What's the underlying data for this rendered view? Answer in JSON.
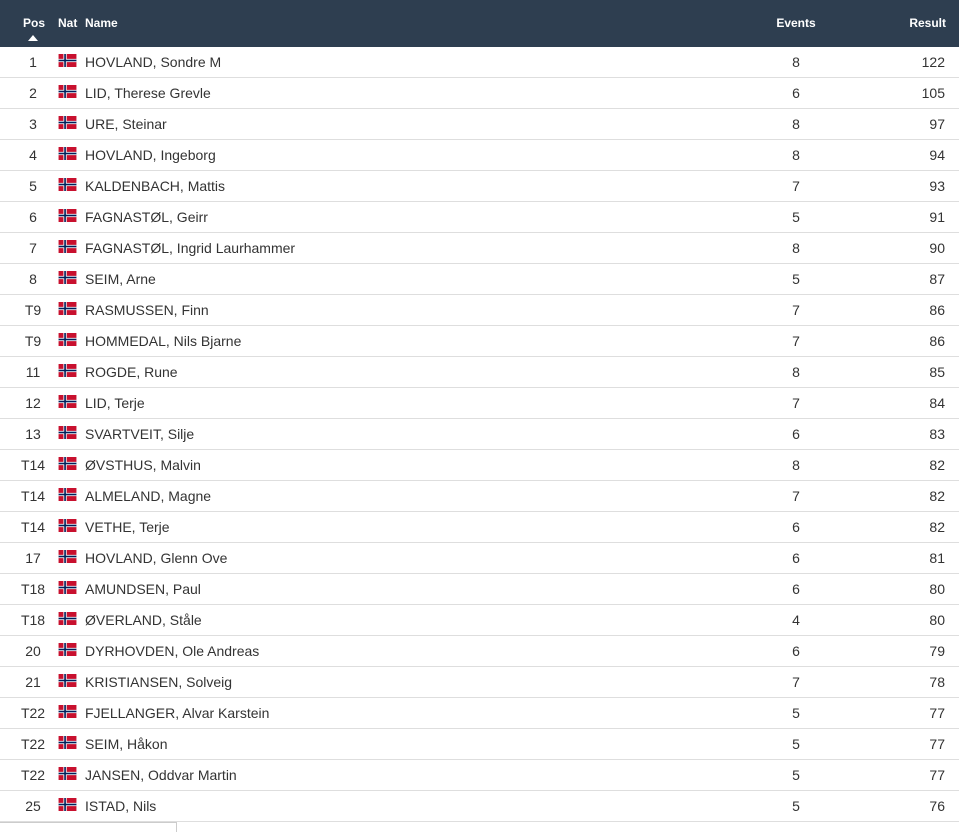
{
  "header": {
    "pos": "Pos",
    "nat": "Nat",
    "name": "Name",
    "events": "Events",
    "result": "Result"
  },
  "flag_colors": {
    "red": "#c8102e",
    "white": "#ffffff",
    "blue": "#00205b"
  },
  "rows": [
    {
      "pos": "1",
      "name": "HOVLAND, Sondre M",
      "events": "8",
      "result": "122"
    },
    {
      "pos": "2",
      "name": "LID, Therese Grevle",
      "events": "6",
      "result": "105"
    },
    {
      "pos": "3",
      "name": "URE, Steinar",
      "events": "8",
      "result": "97"
    },
    {
      "pos": "4",
      "name": "HOVLAND, Ingeborg",
      "events": "8",
      "result": "94"
    },
    {
      "pos": "5",
      "name": "KALDENBACH, Mattis",
      "events": "7",
      "result": "93"
    },
    {
      "pos": "6",
      "name": "FAGNASTØL, Geirr",
      "events": "5",
      "result": "91"
    },
    {
      "pos": "7",
      "name": "FAGNASTØL, Ingrid Laurhammer",
      "events": "8",
      "result": "90"
    },
    {
      "pos": "8",
      "name": "SEIM, Arne",
      "events": "5",
      "result": "87"
    },
    {
      "pos": "T9",
      "name": "RASMUSSEN, Finn",
      "events": "7",
      "result": "86"
    },
    {
      "pos": "T9",
      "name": "HOMMEDAL, Nils Bjarne",
      "events": "7",
      "result": "86"
    },
    {
      "pos": "11",
      "name": "ROGDE, Rune",
      "events": "8",
      "result": "85"
    },
    {
      "pos": "12",
      "name": "LID, Terje",
      "events": "7",
      "result": "84"
    },
    {
      "pos": "13",
      "name": "SVARTVEIT, Silje",
      "events": "6",
      "result": "83"
    },
    {
      "pos": "T14",
      "name": "ØVSTHUS, Malvin",
      "events": "8",
      "result": "82"
    },
    {
      "pos": "T14",
      "name": "ALMELAND, Magne",
      "events": "7",
      "result": "82"
    },
    {
      "pos": "T14",
      "name": "VETHE, Terje",
      "events": "6",
      "result": "82"
    },
    {
      "pos": "17",
      "name": "HOVLAND, Glenn Ove",
      "events": "6",
      "result": "81"
    },
    {
      "pos": "T18",
      "name": "AMUNDSEN, Paul",
      "events": "6",
      "result": "80"
    },
    {
      "pos": "T18",
      "name": "ØVERLAND, Ståle",
      "events": "4",
      "result": "80"
    },
    {
      "pos": "20",
      "name": "DYRHOVDEN, Ole Andreas",
      "events": "6",
      "result": "79"
    },
    {
      "pos": "21",
      "name": "KRISTIANSEN, Solveig",
      "events": "7",
      "result": "78"
    },
    {
      "pos": "T22",
      "name": "FJELLANGER, Alvar Karstein",
      "events": "5",
      "result": "77"
    },
    {
      "pos": "T22",
      "name": "SEIM, Håkon",
      "events": "5",
      "result": "77"
    },
    {
      "pos": "T22",
      "name": "JANSEN, Oddvar Martin",
      "events": "5",
      "result": "77"
    },
    {
      "pos": "25",
      "name": "ISTAD, Nils",
      "events": "5",
      "result": "76"
    }
  ]
}
